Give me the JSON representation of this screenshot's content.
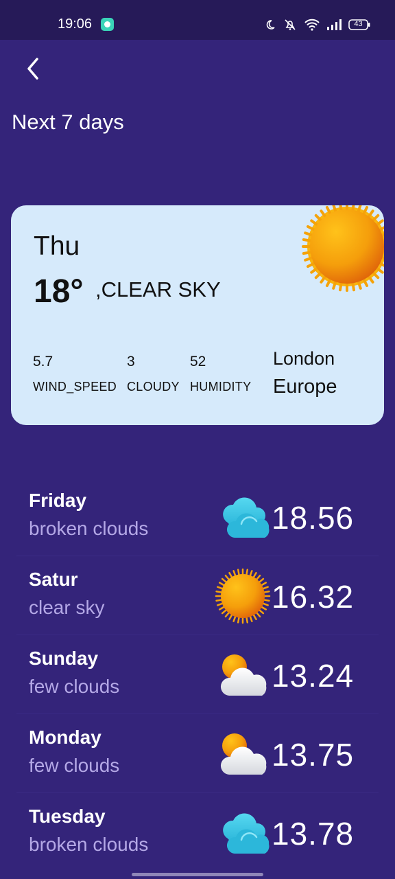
{
  "status_bar": {
    "time": "19:06",
    "battery": "43",
    "icons": [
      "chat-app-icon",
      "moon-icon",
      "mute-icon",
      "wifi-icon",
      "signal-icon",
      "battery-icon"
    ]
  },
  "header": {
    "back_icon": "chevron-left-icon",
    "title": "Next 7 days"
  },
  "today": {
    "day": "Thu",
    "temp": "18°",
    "condition": ",CLEAR SKY",
    "icon": "sun-icon",
    "stats": [
      {
        "value": "5.7",
        "label": "WIND_SPEED"
      },
      {
        "value": "3",
        "label": "CLOUDY"
      },
      {
        "value": "52",
        "label": "HUMIDITY"
      }
    ],
    "city": "London",
    "region": "Europe"
  },
  "forecast": [
    {
      "day": "Friday",
      "desc": "broken clouds",
      "temp": "18.56",
      "icon": "broken-clouds-icon"
    },
    {
      "day": "Satur",
      "desc": "clear sky",
      "temp": "16.32",
      "icon": "sun-icon"
    },
    {
      "day": "Sunday",
      "desc": "few clouds",
      "temp": "13.24",
      "icon": "few-clouds-icon"
    },
    {
      "day": "Monday",
      "desc": "few clouds",
      "temp": "13.75",
      "icon": "few-clouds-icon"
    },
    {
      "day": "Tuesday",
      "desc": "broken clouds",
      "temp": "13.78",
      "icon": "broken-clouds-icon"
    }
  ],
  "colors": {
    "background": "#34247a",
    "status_bar": "#261a58",
    "card": "#d6eafb",
    "subtext": "#b4a8e6",
    "sun": "#f5a30a",
    "cloud_blue": "#3cc7e6"
  }
}
